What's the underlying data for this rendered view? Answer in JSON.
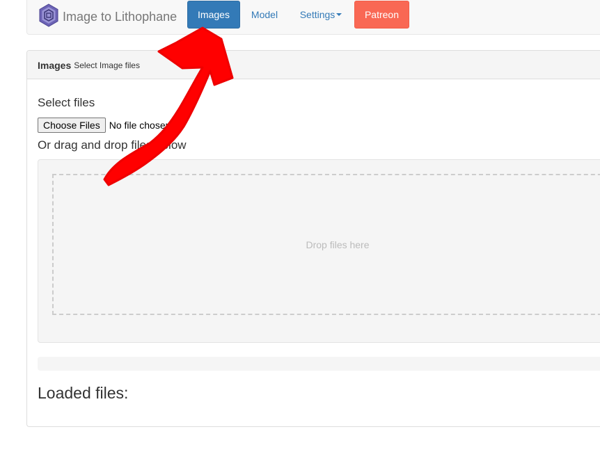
{
  "navbar": {
    "brand_text": "Image to Lithophane",
    "brand_icon": "lithophane-logo-icon",
    "items": [
      {
        "label": "Images"
      },
      {
        "label": "Model"
      },
      {
        "label": "Settings"
      },
      {
        "label": "Patreon"
      }
    ],
    "colors": {
      "active": "#337ab7",
      "patreon": "#f96854",
      "link": "#337ab7"
    }
  },
  "panel": {
    "title": "Images",
    "subtitle": "Select Image files",
    "select_label": "Select files",
    "choose_button": "Choose Files",
    "file_status": "No file chosen",
    "drag_label": "Or drag and drop files below",
    "drop_text": "Drop files here",
    "loaded_label": "Loaded files:"
  },
  "annotation": {
    "arrow_color": "#ff0000",
    "arrow_icon": "red-arrow-annotation"
  }
}
